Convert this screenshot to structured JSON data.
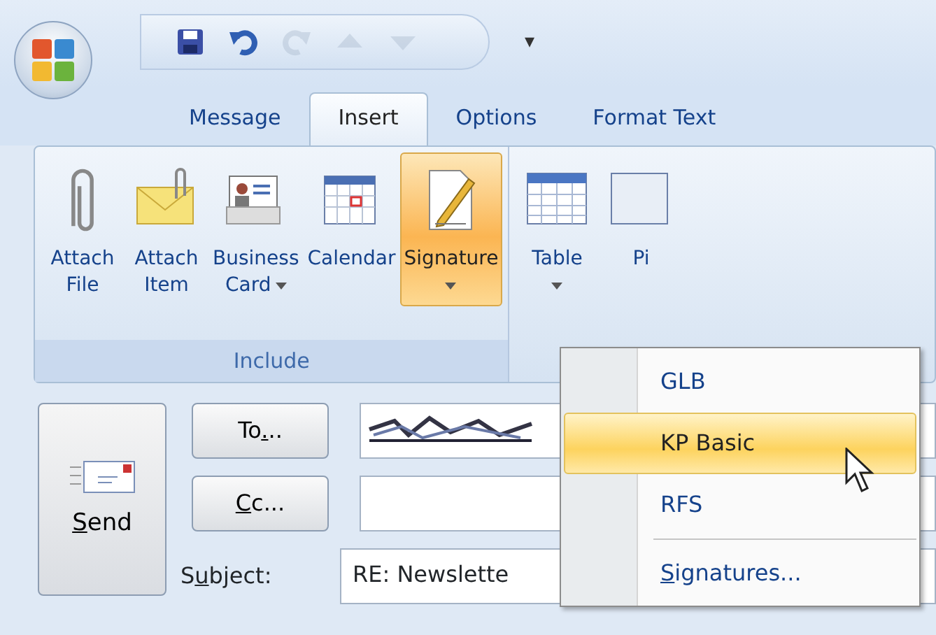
{
  "quick_access": {
    "items": [
      {
        "kind": "save",
        "disabled": false
      },
      {
        "kind": "undo",
        "disabled": false
      },
      {
        "kind": "redo",
        "disabled": true
      },
      {
        "kind": "up",
        "disabled": true
      },
      {
        "kind": "down",
        "disabled": true
      }
    ],
    "customize": "▾"
  },
  "tabs": [
    {
      "label": "Message",
      "selected": false
    },
    {
      "label": "Insert",
      "selected": true
    },
    {
      "label": "Options",
      "selected": false
    },
    {
      "label": "Format Text",
      "selected": false
    }
  ],
  "ribbon": {
    "buttons": [
      {
        "kind": "paperclip",
        "lines": [
          "Attach",
          "File"
        ],
        "dropdown": false,
        "highlighted": false
      },
      {
        "kind": "envelope",
        "lines": [
          "Attach",
          "Item"
        ],
        "dropdown": false,
        "highlighted": false
      },
      {
        "kind": "card",
        "lines": [
          "Business",
          "Card"
        ],
        "dropdown": true,
        "highlighted": false
      },
      {
        "kind": "calendar",
        "lines": [
          "Calendar"
        ],
        "dropdown": false,
        "highlighted": false
      },
      {
        "kind": "signature",
        "lines": [
          "Signature"
        ],
        "dropdown": true,
        "highlighted": true
      }
    ],
    "group_label": "Include",
    "more_buttons": [
      {
        "kind": "table",
        "lines": [
          "Table"
        ],
        "dropdown": true,
        "highlighted": false
      },
      {
        "kind": "picture",
        "lines": [
          "Pi"
        ],
        "dropdown": false,
        "highlighted": false
      }
    ]
  },
  "compose": {
    "send": {
      "key": "S",
      "after": "end"
    },
    "to": {
      "before": "To",
      "key": ".",
      "after": ".."
    },
    "cc": {
      "key": "C",
      "after": "c..."
    },
    "subject_label": {
      "before": "S",
      "key": "u",
      "after": "bject:"
    },
    "subject_value": "RE: Newslette"
  },
  "signature_menu": {
    "items": [
      {
        "kind": "item",
        "label": {
          "before": "GLB"
        },
        "selected": false
      },
      {
        "kind": "item",
        "label": {
          "before": "KP Basic"
        },
        "selected": true
      },
      {
        "kind": "item",
        "label": {
          "before": "RFS"
        },
        "selected": false
      },
      {
        "kind": "separator"
      },
      {
        "kind": "item",
        "label": {
          "key": "S",
          "after": "ignatures..."
        },
        "selected": false
      }
    ]
  }
}
